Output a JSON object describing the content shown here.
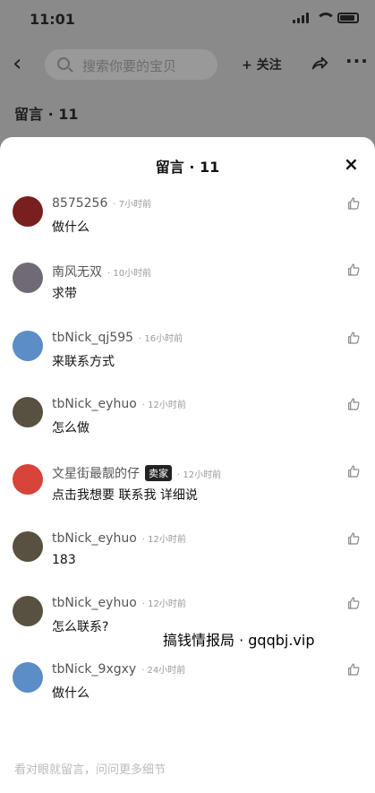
{
  "status": {
    "time": "11:01"
  },
  "navbar": {
    "search_placeholder": "搜索你要的宝贝",
    "follow_label": "+ 关注"
  },
  "background": {
    "title": "留言 · 11"
  },
  "sheet": {
    "title": "留言 · 11",
    "close": "×"
  },
  "comments": [
    {
      "name": "8575256",
      "time": "7小时前",
      "text": "做什么",
      "avatar_color": "#7a1f1f"
    },
    {
      "name": "南风无双",
      "time": "10小时前",
      "text": "求带",
      "avatar_color": "#6f6a73"
    },
    {
      "name": "tbNick_qj595",
      "time": "16小时前",
      "text": "来联系方式",
      "avatar_color": "#5b8dc6"
    },
    {
      "name": "tbNick_eyhuo",
      "time": "12小时前",
      "text": "怎么做",
      "avatar_color": "#585040"
    },
    {
      "name": "文星街最靓的仔",
      "badge": "卖家",
      "time": "12小时前",
      "text": "点击我想要  联系我  详细说",
      "avatar_color": "#d7443a"
    },
    {
      "name": "tbNick_eyhuo",
      "time": "12小时前",
      "text": "183",
      "avatar_color": "#585040"
    },
    {
      "name": "tbNick_eyhuo",
      "time": "12小时前",
      "text": "怎么联系?",
      "avatar_color": "#585040"
    },
    {
      "name": "tbNick_9xgxy",
      "time": "24小时前",
      "text": "做什么",
      "avatar_color": "#5b8dc6"
    }
  ],
  "footer": {
    "placeholder": "看对眼就留言，问问更多细节"
  },
  "watermark": "搞钱情报局 · gqqbj.vip"
}
